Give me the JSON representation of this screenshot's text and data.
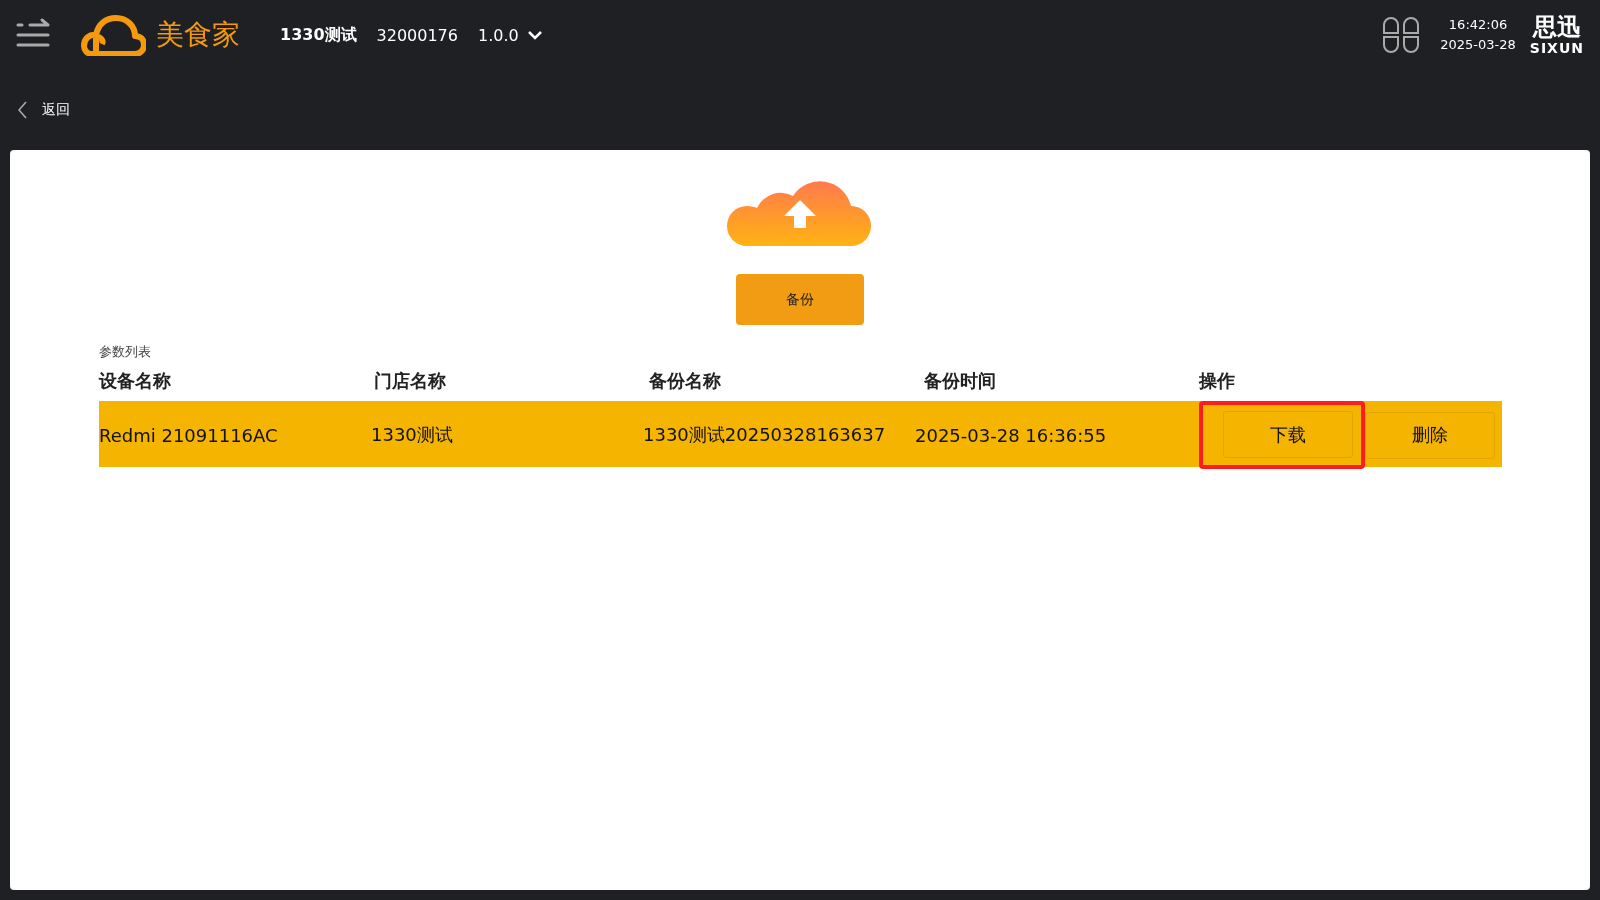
{
  "header": {
    "brand": "美食家",
    "store": "1330测试",
    "store_code": "32000176",
    "version": "1.0.0",
    "time": "16:42:06",
    "date": "2025-03-28",
    "vendor_logo": "思迅",
    "vendor_logo_sub": "SIXUN"
  },
  "back": {
    "label": "返回"
  },
  "backup_button": {
    "label": "备份"
  },
  "table": {
    "title": "参数列表",
    "columns": [
      "设备名称",
      "门店名称",
      "备份名称",
      "备份时间",
      "操作"
    ],
    "rows": [
      {
        "cells": [
          "Redmi 21091116AC",
          "1330测试",
          "1330测试20250328163637",
          "2025-03-28 16:36:55"
        ],
        "selected": true,
        "actions": [
          {
            "label": "下载",
            "highlighted": true
          },
          {
            "label": "删除",
            "highlighted": false
          }
        ]
      }
    ]
  }
}
